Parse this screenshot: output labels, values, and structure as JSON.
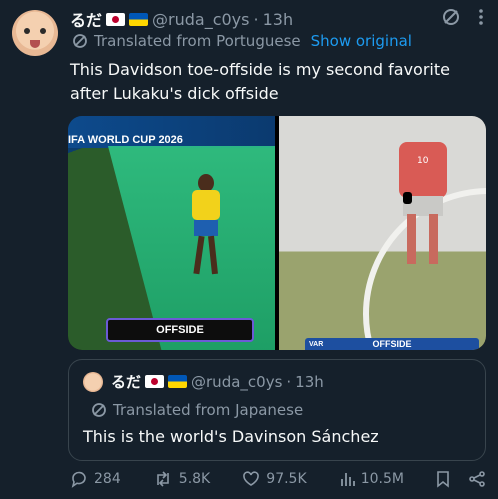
{
  "author": {
    "display_name": "るだ🇯🇵🇺🇦",
    "name_text": "るだ",
    "handle": "@ruda_c0ys",
    "separator": "·",
    "time": "13h"
  },
  "translation": {
    "label": "Translated from Portuguese",
    "show_original": "Show original"
  },
  "post_text": "This Davidson toe-offside is my second favorite after Lukaku's dick offside",
  "media": {
    "left_banner": "IFA WORLD CUP 2026",
    "left_caption": "OFFSIDE",
    "right_caption": "OFFSIDE",
    "right_tag": "VAR"
  },
  "quote": {
    "name_text": "るだ",
    "handle": "@ruda_c0ys",
    "separator": "·",
    "time": "13h",
    "translation_label": "Translated from Japanese",
    "text": "This is the world's Davinson Sánchez"
  },
  "actions": {
    "replies": "284",
    "reposts": "5.8K",
    "likes": "97.5K",
    "views": "10.5M"
  },
  "colors": {
    "background": "#15202b",
    "link": "#1d9bf0",
    "muted": "#8b98a5"
  }
}
